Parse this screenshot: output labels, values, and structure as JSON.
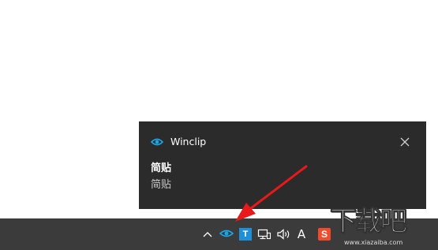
{
  "notification": {
    "app_name": "Winclip",
    "app_icon": "eye-icon",
    "title": "简贴",
    "body": "简贴",
    "close_icon": "close-icon"
  },
  "taskbar": {
    "tray": {
      "chevron_icon": "chevron-up-icon",
      "winclip_icon": "eye-icon",
      "t_app_label": "T",
      "network_icon": "network-icon",
      "volume_icon": "volume-icon",
      "ime_label": "A",
      "sogou_label": "S"
    }
  },
  "annotation": {
    "arrow_color": "#e8191a"
  },
  "watermark": {
    "text": "下载吧",
    "url": "www.xiazaiba.com"
  },
  "colors": {
    "toast_bg": "#2b2b2b",
    "taskbar_bg": "#3b3b3b",
    "accent": "#1aa7e8"
  }
}
